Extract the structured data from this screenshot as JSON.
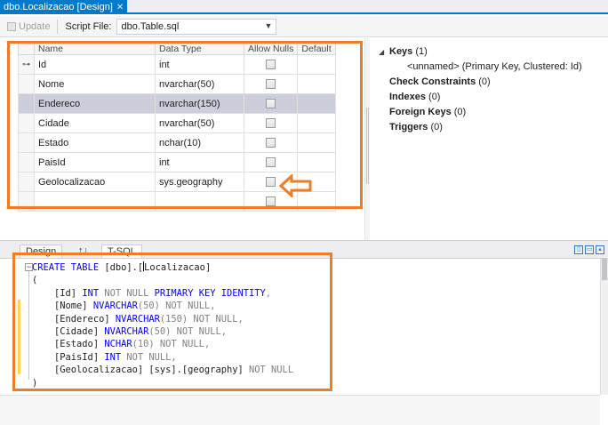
{
  "window": {
    "tab_title": "dbo.Localizacao [Design]"
  },
  "toolbar": {
    "update_label": "Update",
    "script_file_label": "Script File:",
    "script_file_value": "dbo.Table.sql"
  },
  "grid": {
    "headers": {
      "name": "Name",
      "data_type": "Data Type",
      "allow_nulls": "Allow Nulls",
      "default": "Default"
    },
    "rows": [
      {
        "name": "Id",
        "type": "int",
        "is_key": true
      },
      {
        "name": "Nome",
        "type": "nvarchar(50)"
      },
      {
        "name": "Endereco",
        "type": "nvarchar(150)",
        "selected": true
      },
      {
        "name": "Cidade",
        "type": "nvarchar(50)"
      },
      {
        "name": "Estado",
        "type": "nchar(10)"
      },
      {
        "name": "PaisId",
        "type": "int"
      },
      {
        "name": "Geolocalizacao",
        "type": "sys.geography"
      },
      {
        "name": "",
        "type": ""
      }
    ]
  },
  "properties": {
    "keys_label": "Keys",
    "keys_count": "(1)",
    "key_entry": "<unnamed>   (Primary Key, Clustered: Id)",
    "check_constraints_label": "Check Constraints",
    "check_constraints_count": "(0)",
    "indexes_label": "Indexes",
    "indexes_count": "(0)",
    "foreign_keys_label": "Foreign Keys",
    "foreign_keys_count": "(0)",
    "triggers_label": "Triggers",
    "triggers_count": "(0)"
  },
  "bottom_tabs": {
    "design": "Design",
    "swap": "↑↓",
    "tsql": "T-SQL"
  },
  "code": {
    "l1_kw": "CREATE TABLE",
    "l1_pre": " [dbo].[",
    "l1_post": "Localizacao]",
    "l2": "(",
    "l3_name": "    [Id] ",
    "l3_type": "INT",
    "l3_null": " NOT NULL ",
    "l3_kw": "PRIMARY KEY IDENTITY",
    "l3_end": ",",
    "l4_name": "    [Nome] ",
    "l4_type": "NVARCHAR",
    "l4_size": "(50)",
    "l4_null": " NOT NULL",
    "l4_end": ",",
    "l5_name": "    [Endereco] ",
    "l5_type": "NVARCHAR",
    "l5_size": "(150)",
    "l5_null": " NOT NULL",
    "l5_end": ",",
    "l6_name": "    [Cidade] ",
    "l6_type": "NVARCHAR",
    "l6_size": "(50)",
    "l6_null": " NOT NULL",
    "l6_end": ",",
    "l7_name": "    [Estado] ",
    "l7_type": "NCHAR",
    "l7_size": "(10)",
    "l7_null": " NOT NULL",
    "l7_end": ",",
    "l8_name": "    [PaisId] ",
    "l8_type": "INT",
    "l8_null": " NOT NULL",
    "l8_end": ",",
    "l9_name": "    [Geolocalizacao] [sys].[geography]",
    "l9_null": " NOT NULL",
    "l10": ")"
  },
  "colors": {
    "accent": "#007acc",
    "annotation": "#f07d24",
    "keyword": "#0000ff",
    "muted": "#808080",
    "selected_row": "#cccedb"
  }
}
